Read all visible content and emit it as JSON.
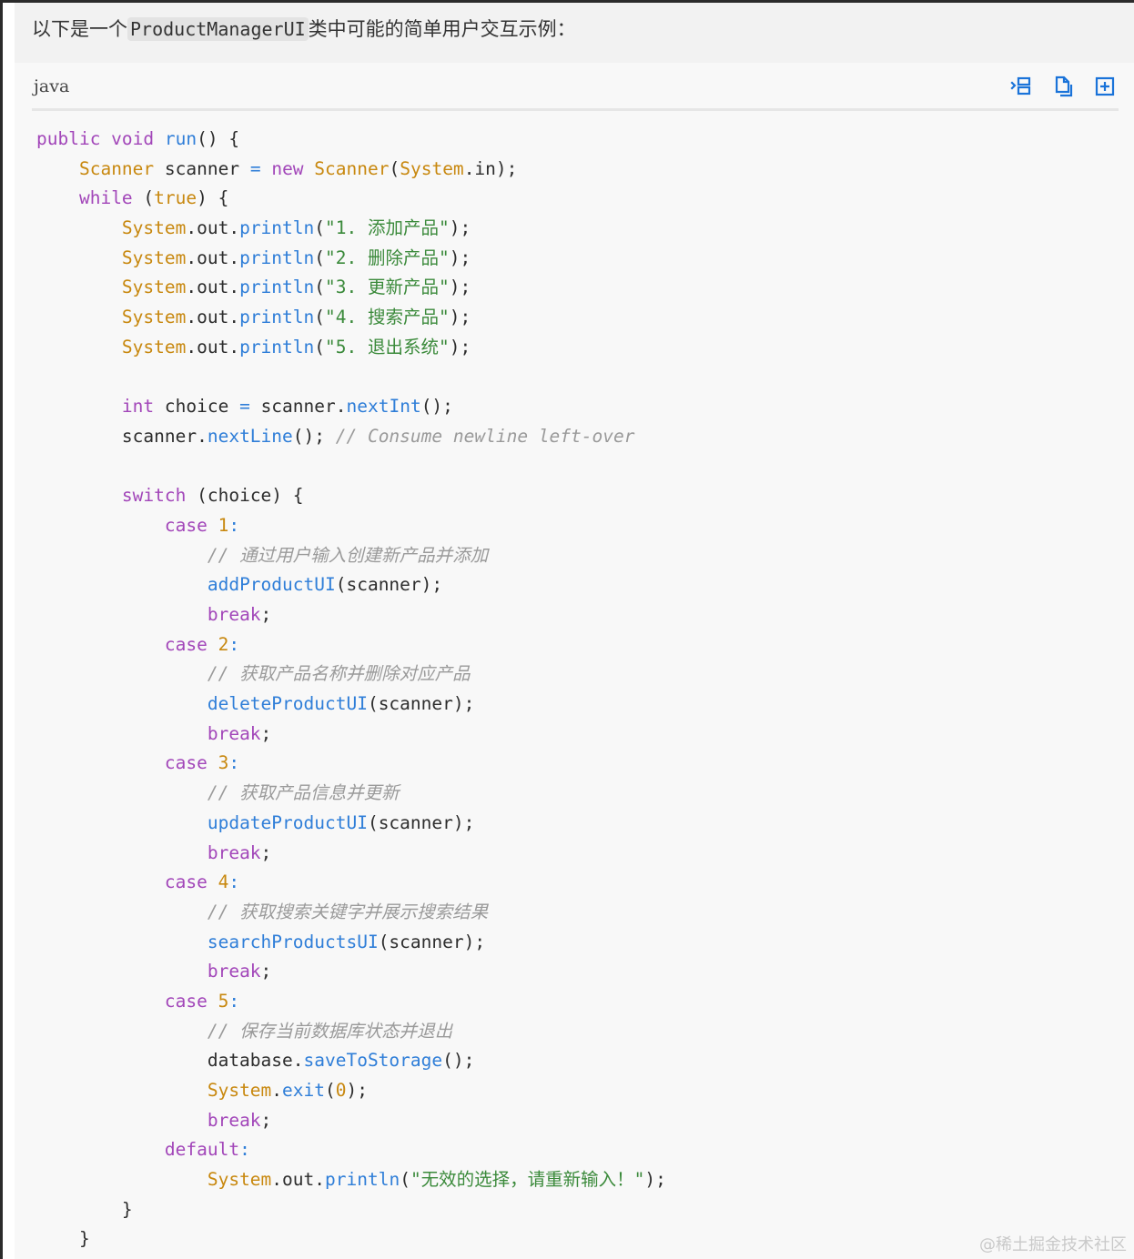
{
  "intro": {
    "prefix": "以下是一个",
    "class_name": "ProductManagerUI",
    "suffix": "类中可能的简单用户交互示例："
  },
  "code_block": {
    "language": "java",
    "toolbar": [
      {
        "name": "expand-lines-icon"
      },
      {
        "name": "copy-icon"
      },
      {
        "name": "add-box-icon"
      }
    ],
    "lines": [
      [
        {
          "t": "public void ",
          "c": "kw"
        },
        {
          "t": "run",
          "c": "fn"
        },
        {
          "t": "() {"
        }
      ],
      [
        {
          "t": "    "
        },
        {
          "t": "Scanner",
          "c": "type"
        },
        {
          "t": " scanner "
        },
        {
          "t": "=",
          "c": "op"
        },
        {
          "t": " "
        },
        {
          "t": "new ",
          "c": "kw"
        },
        {
          "t": "Scanner",
          "c": "type"
        },
        {
          "t": "("
        },
        {
          "t": "System",
          "c": "type"
        },
        {
          "t": ".in);"
        }
      ],
      [
        {
          "t": "    "
        },
        {
          "t": "while",
          "c": "kw"
        },
        {
          "t": " ("
        },
        {
          "t": "true",
          "c": "type"
        },
        {
          "t": ") {"
        }
      ],
      [
        {
          "t": "        "
        },
        {
          "t": "System",
          "c": "type"
        },
        {
          "t": ".out."
        },
        {
          "t": "println",
          "c": "fn"
        },
        {
          "t": "("
        },
        {
          "t": "\"1. 添加产品\"",
          "c": "str"
        },
        {
          "t": ");"
        }
      ],
      [
        {
          "t": "        "
        },
        {
          "t": "System",
          "c": "type"
        },
        {
          "t": ".out."
        },
        {
          "t": "println",
          "c": "fn"
        },
        {
          "t": "("
        },
        {
          "t": "\"2. 删除产品\"",
          "c": "str"
        },
        {
          "t": ");"
        }
      ],
      [
        {
          "t": "        "
        },
        {
          "t": "System",
          "c": "type"
        },
        {
          "t": ".out."
        },
        {
          "t": "println",
          "c": "fn"
        },
        {
          "t": "("
        },
        {
          "t": "\"3. 更新产品\"",
          "c": "str"
        },
        {
          "t": ");"
        }
      ],
      [
        {
          "t": "        "
        },
        {
          "t": "System",
          "c": "type"
        },
        {
          "t": ".out."
        },
        {
          "t": "println",
          "c": "fn"
        },
        {
          "t": "("
        },
        {
          "t": "\"4. 搜索产品\"",
          "c": "str"
        },
        {
          "t": ");"
        }
      ],
      [
        {
          "t": "        "
        },
        {
          "t": "System",
          "c": "type"
        },
        {
          "t": ".out."
        },
        {
          "t": "println",
          "c": "fn"
        },
        {
          "t": "("
        },
        {
          "t": "\"5. 退出系统\"",
          "c": "str"
        },
        {
          "t": ");"
        }
      ],
      [],
      [
        {
          "t": "        "
        },
        {
          "t": "int",
          "c": "kw"
        },
        {
          "t": " choice "
        },
        {
          "t": "=",
          "c": "op"
        },
        {
          "t": " scanner."
        },
        {
          "t": "nextInt",
          "c": "fn"
        },
        {
          "t": "();"
        }
      ],
      [
        {
          "t": "        scanner."
        },
        {
          "t": "nextLine",
          "c": "fn"
        },
        {
          "t": "(); "
        },
        {
          "t": "// Consume newline left-over",
          "c": "cmt"
        }
      ],
      [],
      [
        {
          "t": "        "
        },
        {
          "t": "switch",
          "c": "kw"
        },
        {
          "t": " (choice) {"
        }
      ],
      [
        {
          "t": "            "
        },
        {
          "t": "case",
          "c": "kw"
        },
        {
          "t": " "
        },
        {
          "t": "1",
          "c": "num"
        },
        {
          "t": ":",
          "c": "op"
        }
      ],
      [
        {
          "t": "                "
        },
        {
          "t": "// 通过用户输入创建新产品并添加",
          "c": "cmt"
        }
      ],
      [
        {
          "t": "                "
        },
        {
          "t": "addProductUI",
          "c": "fn"
        },
        {
          "t": "(scanner);"
        }
      ],
      [
        {
          "t": "                "
        },
        {
          "t": "break",
          "c": "kw"
        },
        {
          "t": ";"
        }
      ],
      [
        {
          "t": "            "
        },
        {
          "t": "case",
          "c": "kw"
        },
        {
          "t": " "
        },
        {
          "t": "2",
          "c": "num"
        },
        {
          "t": ":",
          "c": "op"
        }
      ],
      [
        {
          "t": "                "
        },
        {
          "t": "// 获取产品名称并删除对应产品",
          "c": "cmt"
        }
      ],
      [
        {
          "t": "                "
        },
        {
          "t": "deleteProductUI",
          "c": "fn"
        },
        {
          "t": "(scanner);"
        }
      ],
      [
        {
          "t": "                "
        },
        {
          "t": "break",
          "c": "kw"
        },
        {
          "t": ";"
        }
      ],
      [
        {
          "t": "            "
        },
        {
          "t": "case",
          "c": "kw"
        },
        {
          "t": " "
        },
        {
          "t": "3",
          "c": "num"
        },
        {
          "t": ":",
          "c": "op"
        }
      ],
      [
        {
          "t": "                "
        },
        {
          "t": "// 获取产品信息并更新",
          "c": "cmt"
        }
      ],
      [
        {
          "t": "                "
        },
        {
          "t": "updateProductUI",
          "c": "fn"
        },
        {
          "t": "(scanner);"
        }
      ],
      [
        {
          "t": "                "
        },
        {
          "t": "break",
          "c": "kw"
        },
        {
          "t": ";"
        }
      ],
      [
        {
          "t": "            "
        },
        {
          "t": "case",
          "c": "kw"
        },
        {
          "t": " "
        },
        {
          "t": "4",
          "c": "num"
        },
        {
          "t": ":",
          "c": "op"
        }
      ],
      [
        {
          "t": "                "
        },
        {
          "t": "// 获取搜索关键字并展示搜索结果",
          "c": "cmt"
        }
      ],
      [
        {
          "t": "                "
        },
        {
          "t": "searchProductsUI",
          "c": "fn"
        },
        {
          "t": "(scanner);"
        }
      ],
      [
        {
          "t": "                "
        },
        {
          "t": "break",
          "c": "kw"
        },
        {
          "t": ";"
        }
      ],
      [
        {
          "t": "            "
        },
        {
          "t": "case",
          "c": "kw"
        },
        {
          "t": " "
        },
        {
          "t": "5",
          "c": "num"
        },
        {
          "t": ":",
          "c": "op"
        }
      ],
      [
        {
          "t": "                "
        },
        {
          "t": "// 保存当前数据库状态并退出",
          "c": "cmt"
        }
      ],
      [
        {
          "t": "                database."
        },
        {
          "t": "saveToStorage",
          "c": "fn"
        },
        {
          "t": "();"
        }
      ],
      [
        {
          "t": "                "
        },
        {
          "t": "System",
          "c": "type"
        },
        {
          "t": "."
        },
        {
          "t": "exit",
          "c": "fn"
        },
        {
          "t": "("
        },
        {
          "t": "0",
          "c": "num"
        },
        {
          "t": ");"
        }
      ],
      [
        {
          "t": "                "
        },
        {
          "t": "break",
          "c": "kw"
        },
        {
          "t": ";"
        }
      ],
      [
        {
          "t": "            "
        },
        {
          "t": "default",
          "c": "kw"
        },
        {
          "t": ":",
          "c": "op"
        }
      ],
      [
        {
          "t": "                "
        },
        {
          "t": "System",
          "c": "type"
        },
        {
          "t": ".out."
        },
        {
          "t": "println",
          "c": "fn"
        },
        {
          "t": "("
        },
        {
          "t": "\"无效的选择，请重新输入！\"",
          "c": "str"
        },
        {
          "t": ");"
        }
      ],
      [
        {
          "t": "        }"
        }
      ],
      [
        {
          "t": "    }"
        }
      ]
    ]
  },
  "watermark": "@稀土掘金技术社区",
  "colors": {
    "keyword": "#a246b9",
    "type": "#c8880f",
    "function": "#2f7ed8",
    "string": "#3b8a3b",
    "comment": "#9a9a9a",
    "toolbar_icon": "#1a73d9"
  }
}
